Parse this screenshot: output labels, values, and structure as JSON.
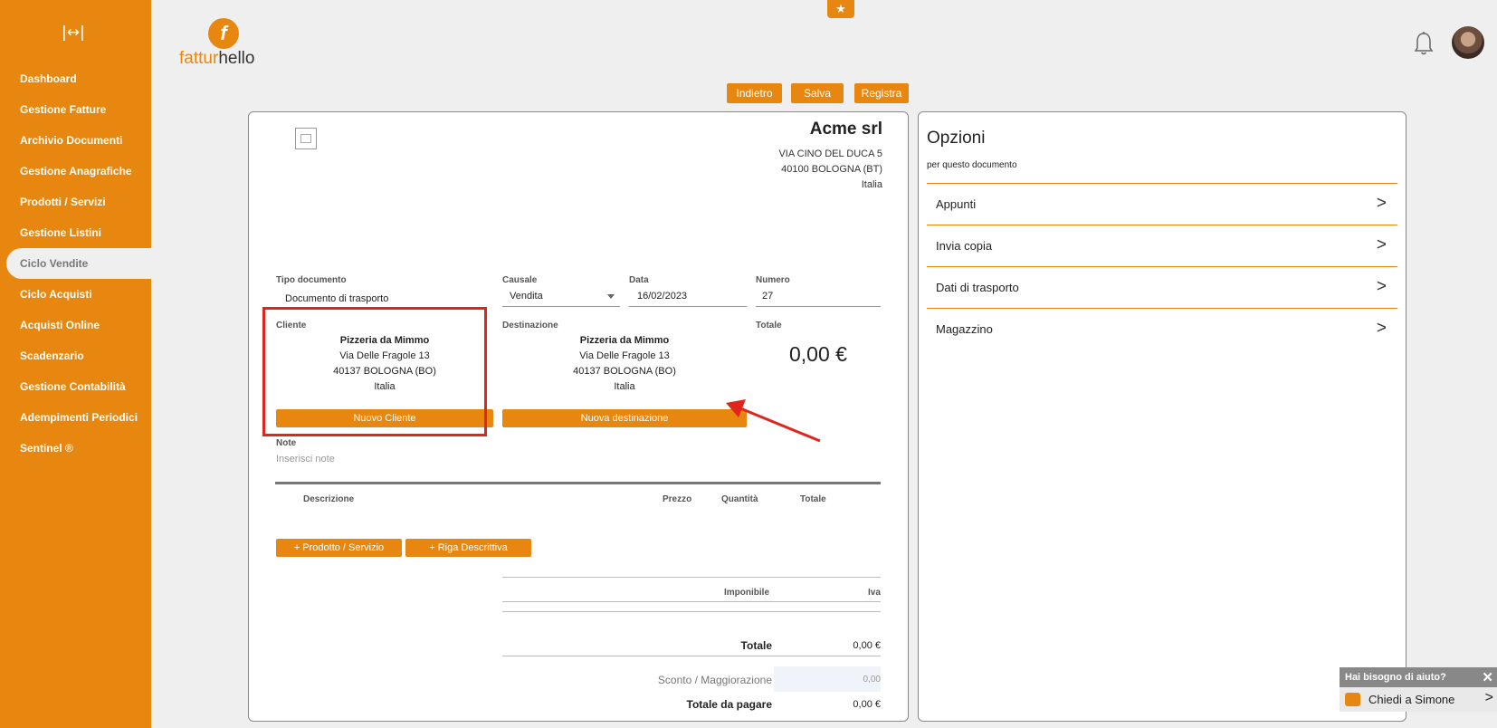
{
  "sidebar": {
    "collapse_icon": "|↔|",
    "items": [
      {
        "label": "Dashboard"
      },
      {
        "label": "Gestione Fatture"
      },
      {
        "label": "Archivio Documenti"
      },
      {
        "label": "Gestione Anagrafiche"
      },
      {
        "label": "Prodotti / Servizi"
      },
      {
        "label": "Gestione Listini"
      },
      {
        "label": "Ciclo Vendite"
      },
      {
        "label": "Ciclo Acquisti"
      },
      {
        "label": "Acquisti Online"
      },
      {
        "label": "Scadenzario"
      },
      {
        "label": "Gestione Contabilità"
      },
      {
        "label": "Adempimenti Periodici"
      },
      {
        "label": "Sentinel ®"
      }
    ]
  },
  "logo": {
    "part1": "fattur",
    "part2": "hello",
    "mark": "f"
  },
  "toolbar": {
    "back": "Indietro",
    "save": "Salva",
    "register": "Registra"
  },
  "company": {
    "name": "Acme srl",
    "address": "VIA CINO DEL DUCA 5",
    "city": "40100 BOLOGNA (BT)",
    "country": "Italia"
  },
  "document": {
    "type_label": "Tipo documento",
    "type_value": "Documento di trasporto",
    "causale_label": "Causale",
    "causale_value": "Vendita",
    "date_label": "Data",
    "date_value": "16/02/2023",
    "number_label": "Numero",
    "number_value": "27"
  },
  "cliente": {
    "label": "Cliente",
    "name": "Pizzeria da Mimmo",
    "street": "Via Delle Fragole 13",
    "city": "40137 BOLOGNA (BO)",
    "country": "Italia",
    "button": "Nuovo Cliente"
  },
  "destinazione": {
    "label": "Destinazione",
    "name": "Pizzeria da Mimmo",
    "street": "Via Delle Fragole 13",
    "city": "40137 BOLOGNA (BO)",
    "country": "Italia",
    "button": "Nuova destinazione"
  },
  "totale": {
    "label": "Totale",
    "value": "0,00 €"
  },
  "note": {
    "label": "Note",
    "placeholder": "Inserisci note"
  },
  "lines_table": {
    "headers": [
      "Descrizione",
      "Prezzo",
      "Quantità",
      "Totale"
    ],
    "add_product": "+ Prodotto / Servizio",
    "add_description_row": "+ Riga Descrittiva"
  },
  "summary": {
    "imponibile": "Imponibile",
    "iva": "Iva",
    "totale_label": "Totale",
    "totale_value": "0,00 €",
    "discount_label": "Sconto / Maggiorazione",
    "discount_value": "0,00",
    "to_pay_label": "Totale da pagare",
    "to_pay_value": "0,00 €"
  },
  "options": {
    "title": "Opzioni",
    "subtitle": "per questo documento",
    "items": [
      {
        "label": "Appunti"
      },
      {
        "label": "Invia copia"
      },
      {
        "label": "Dati di trasporto"
      },
      {
        "label": "Magazzino"
      }
    ]
  },
  "help": {
    "title": "Hai bisogno di aiuto?",
    "action": "Chiedi a Simone"
  },
  "colors": {
    "accent": "#e8870f",
    "highlight": "#e0261c"
  }
}
